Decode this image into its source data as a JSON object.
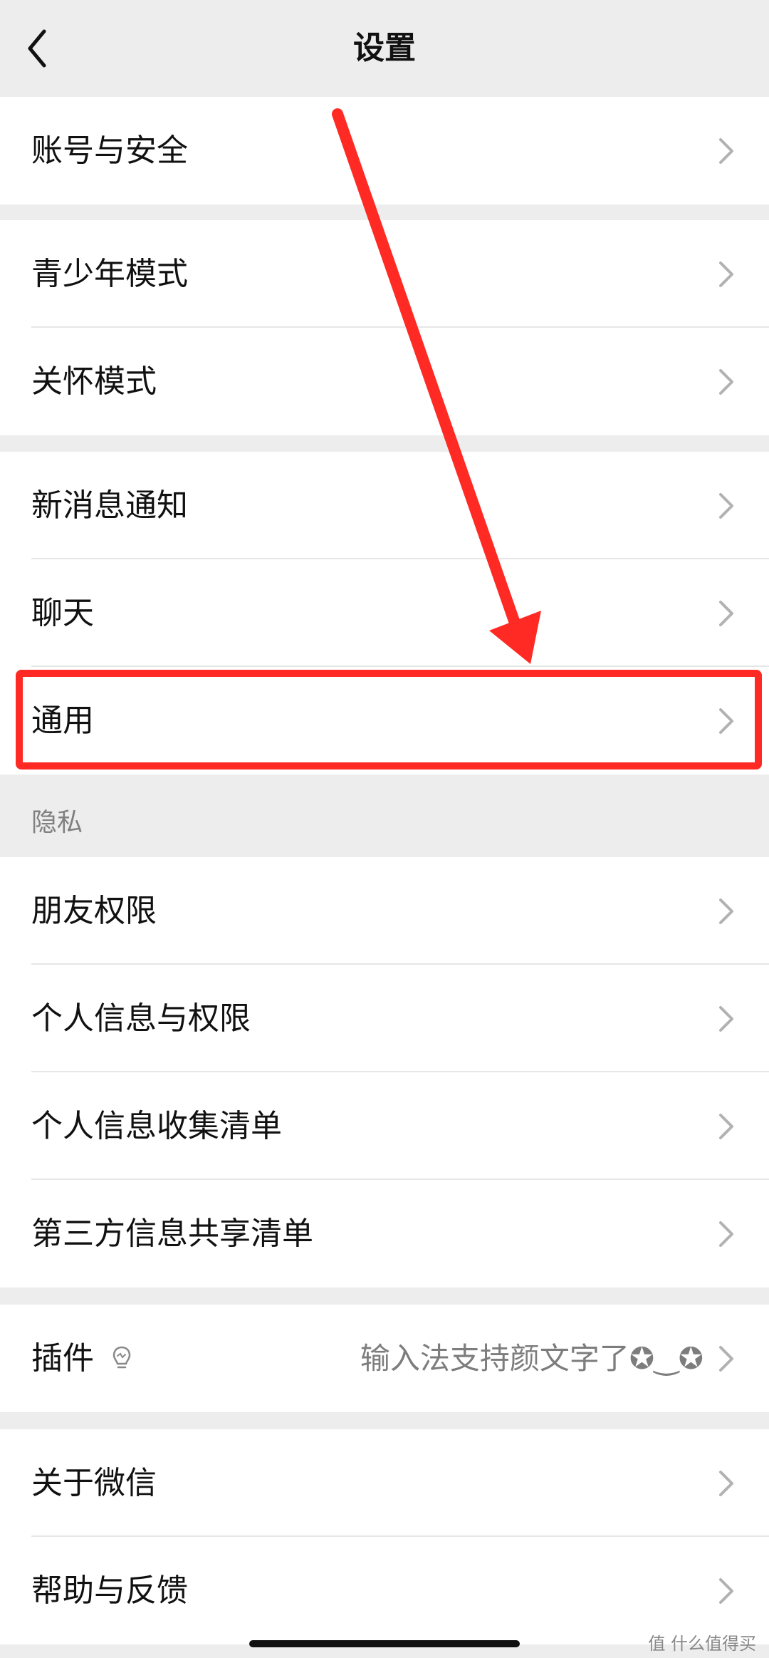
{
  "nav": {
    "title": "设置",
    "back_icon": "chevron-left-icon"
  },
  "groups": {
    "g1": [
      "账号与安全"
    ],
    "g2": [
      "青少年模式",
      "关怀模式"
    ],
    "g3": [
      "新消息通知",
      "聊天",
      "通用"
    ],
    "g4": [
      "朋友权限",
      "个人信息与权限",
      "个人信息收集清单",
      "第三方信息共享清单"
    ],
    "g5": {
      "label": "插件",
      "icon": "lightbulb-icon",
      "hint": "输入法支持颜文字了✪‿✪"
    },
    "g6": [
      "关于微信",
      "帮助与反馈"
    ]
  },
  "privacy_header": "隐私",
  "annotation": {
    "highlighted_item": "通用",
    "color": "#ff2a24"
  },
  "watermark": "值 什么值得买",
  "colors": {
    "background": "#ededed",
    "cell": "#ffffff",
    "text": "#111111",
    "secondary": "#808080"
  }
}
